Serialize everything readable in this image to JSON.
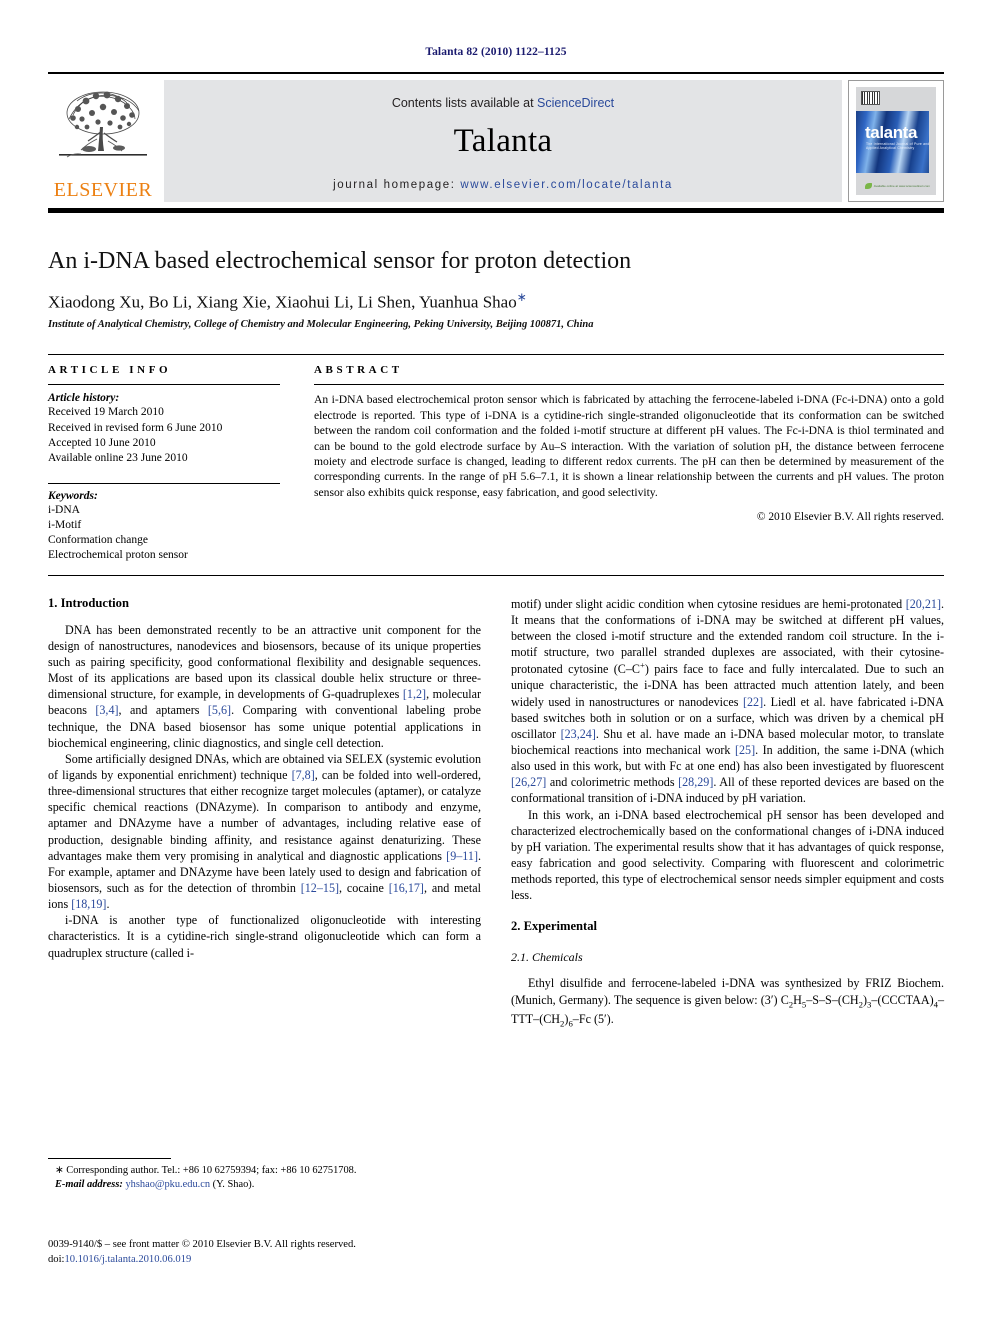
{
  "running_head": "Talanta 82 (2010) 1122–1125",
  "journal_header": {
    "contents_prefix": "Contents lists available at",
    "sciencedirect": "ScienceDirect",
    "journal_name": "Talanta",
    "homepage_label": "journal homepage:",
    "homepage_url": "www.elsevier.com/locate/talanta",
    "publisher_wordmark": "ELSEVIER",
    "cover_title": "talanta",
    "cover_subtitle": "The International Journal of Pure and Applied Analytical Chemistry",
    "cover_footer": "Available online at www.sciencedirect.com"
  },
  "article": {
    "title": "An i-DNA based electrochemical sensor for proton detection",
    "authors": "Xiaodong Xu, Bo Li, Xiang Xie, Xiaohui Li, Li Shen, Yuanhua Shao",
    "corresponding_marker": "∗",
    "affiliation": "Institute of Analytical Chemistry, College of Chemistry and Molecular Engineering, Peking University, Beijing 100871, China"
  },
  "article_info": {
    "heading": "ARTICLE INFO",
    "history_label": "Article history:",
    "history": [
      "Received 19 March 2010",
      "Received in revised form 6 June 2010",
      "Accepted 10 June 2010",
      "Available online 23 June 2010"
    ],
    "keywords_label": "Keywords:",
    "keywords": [
      "i-DNA",
      "i-Motif",
      "Conformation change",
      "Electrochemical proton sensor"
    ]
  },
  "abstract": {
    "heading": "ABSTRACT",
    "text": "An i-DNA based electrochemical proton sensor which is fabricated by attaching the ferrocene-labeled i-DNA (Fc-i-DNA) onto a gold electrode is reported. This type of i-DNA is a cytidine-rich single-stranded oligonucleotide that its conformation can be switched between the random coil conformation and the folded i-motif structure at different pH values. The Fc-i-DNA is thiol terminated and can be bound to the gold electrode surface by Au–S interaction. With the variation of solution pH, the distance between ferrocene moiety and electrode surface is changed, leading to different redox currents. The pH can then be determined by measurement of the corresponding currents. In the range of pH 5.6–7.1, it is shown a linear relationship between the currents and pH values. The proton sensor also exhibits quick response, easy fabrication, and good selectivity.",
    "copyright": "© 2010 Elsevier B.V. All rights reserved."
  },
  "sections": {
    "introduction_heading": "1. Introduction",
    "experimental_heading": "2. Experimental",
    "chemicals_heading": "2.1. Chemicals"
  },
  "body": {
    "left": [
      "DNA has been demonstrated recently to be an attractive unit component for the design of nanostructures, nanodevices and biosensors, because of its unique properties such as pairing specificity, good conformational flexibility and designable sequences. Most of its applications are based upon its classical double helix structure or three-dimensional structure, for example, in developments of G-quadruplexes [1,2], molecular beacons [3,4], and aptamers [5,6]. Comparing with conventional labeling probe technique, the DNA based biosensor has some unique potential applications in biochemical engineering, clinic diagnostics, and single cell detection.",
      "Some artificially designed DNAs, which are obtained via SELEX (systemic evolution of ligands by exponential enrichment) technique [7,8], can be folded into well-ordered, three-dimensional structures that either recognize target molecules (aptamer), or catalyze specific chemical reactions (DNAzyme). In comparison to antibody and enzyme, aptamer and DNAzyme have a number of advantages, including relative ease of production, designable binding affinity, and resistance against denaturizing. These advantages make them very promising in analytical and diagnostic applications [9–11]. For example, aptamer and DNAzyme have been lately used to design and fabrication of biosensors, such as for the detection of thrombin [12–15], cocaine [16,17], and metal ions [18,19].",
      "i-DNA is another type of functionalized oligonucleotide with interesting characteristics. It is a cytidine-rich single-strand oligonucleotide which can form a quadruplex structure (called i-"
    ],
    "right": [
      "motif) under slight acidic condition when cytosine residues are hemi-protonated [20,21]. It means that the conformations of i-DNA may be switched at different pH values, between the closed i-motif structure and the extended random coil structure. In the i-motif structure, two parallel stranded duplexes are associated, with their cytosine-protonated cytosine (C–C+) pairs face to face and fully intercalated. Due to such an unique characteristic, the i-DNA has been attracted much attention lately, and been widely used in nanostructures or nanodevices [22]. Liedl et al. have fabricated i-DNA based switches both in solution or on a surface, which was driven by a chemical pH oscillator [23,24]. Shu et al. have made an i-DNA based molecular motor, to translate biochemical reactions into mechanical work [25]. In addition, the same i-DNA (which also used in this work, but with Fc at one end) has also been investigated by fluorescent [26,27] and colorimetric methods [28,29]. All of these reported devices are based on the conformational transition of i-DNA induced by pH variation.",
      "In this work, an i-DNA based electrochemical pH sensor has been developed and characterized electrochemically based on the conformational changes of i-DNA induced by pH variation. The experimental results show that it has advantages of quick response, easy fabrication and good selectivity. Comparing with fluorescent and colorimetric methods reported, this type of electrochemical sensor needs simpler equipment and costs less.",
      "Ethyl disulfide and ferrocene-labeled i-DNA was synthesized by FRIZ Biochem. (Munich, Germany). The sequence is given below: (3′) C2H5–S–S–(CH2)3–(CCCTAA)4–TTT–(CH2)6–Fc (5′)."
    ]
  },
  "footnotes": {
    "corresponding": "∗ Corresponding author. Tel.: +86 10 62759394; fax: +86 10 62751708.",
    "email_label": "E-mail address:",
    "email": "yhshao@pku.edu.cn",
    "email_suffix": "(Y. Shao).",
    "imprint": "0039-9140/$ – see front matter © 2010 Elsevier B.V. All rights reserved.",
    "doi_label": "doi:",
    "doi": "10.1016/j.talanta.2010.06.019"
  },
  "colors": {
    "link": "#2b4a9b",
    "elsevier_orange": "#ec8012",
    "header_band": "#e3e4e6"
  }
}
